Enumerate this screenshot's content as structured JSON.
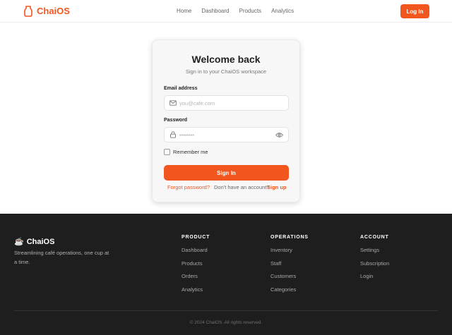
{
  "header": {
    "brand": "ChaiOS",
    "nav": [
      "Home",
      "Dashboard",
      "Products",
      "Analytics"
    ],
    "login_label": "Log In"
  },
  "card": {
    "title": "Welcome back",
    "subtitle": "Sign in to your ChaiOS workspace",
    "email_label": "Email address",
    "email_placeholder": "you@cafe.com",
    "password_label": "Password",
    "password_placeholder": "••••••••",
    "remember_label": "Remember me",
    "signin_label": "Sign In",
    "forgot_label": "Forgot password?",
    "noaccount_text": "Don't have an account?",
    "signup_label": "Sign up"
  },
  "footer": {
    "brand": "ChaiOS",
    "brand_icon": "☕",
    "tagline": "Streamlining café operations, one cup at a time.",
    "columns": [
      {
        "title": "PRODUCT",
        "links": [
          "Dashboard",
          "Products",
          "Orders",
          "Analytics"
        ]
      },
      {
        "title": "OPERATIONS",
        "links": [
          "Inventory",
          "Staff",
          "Customers",
          "Categories"
        ]
      },
      {
        "title": "ACCOUNT",
        "links": [
          "Settings",
          "Subscription",
          "Login"
        ]
      }
    ],
    "copyright": "© 2024 ChaiOS. All rights reserved."
  },
  "colors": {
    "accent": "#f2561f",
    "footer_bg": "#1e1e1e"
  },
  "icons": {
    "brand": "chai-cup-icon",
    "email": "mail-icon",
    "password": "lock-icon",
    "reveal": "eye-icon"
  }
}
